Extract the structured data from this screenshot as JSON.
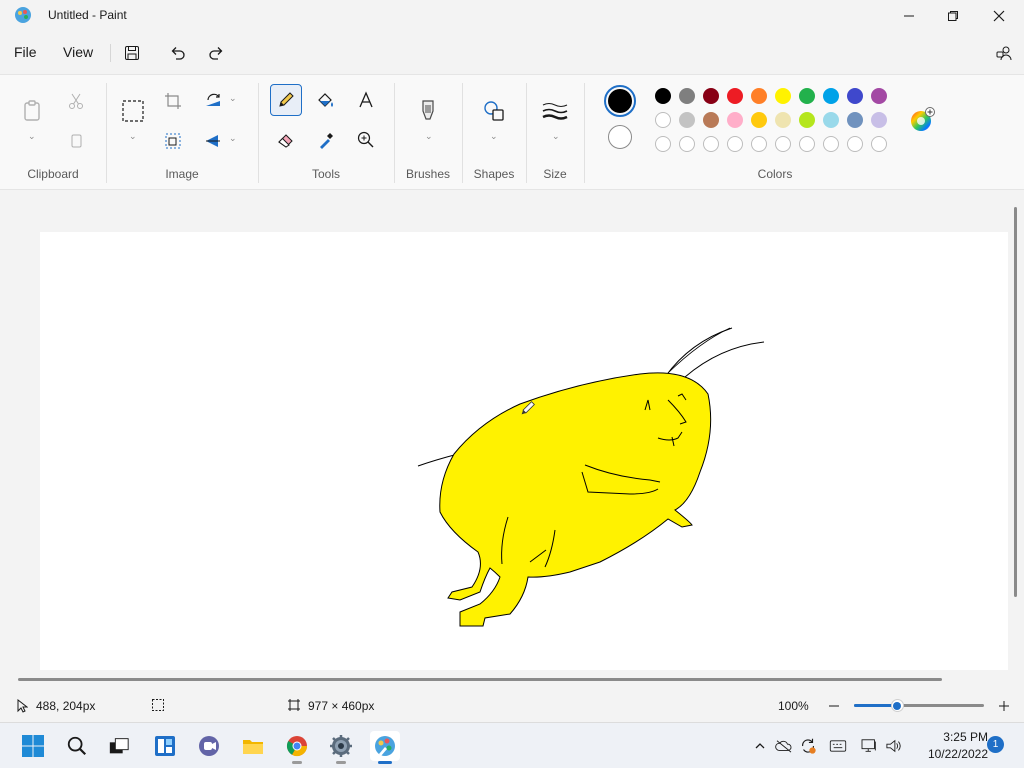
{
  "window": {
    "title": "Untitled - Paint"
  },
  "menu": {
    "file": "File",
    "view": "View"
  },
  "ribbon": {
    "groups": {
      "clipboard": "Clipboard",
      "image": "Image",
      "tools": "Tools",
      "brushes": "Brushes",
      "shapes": "Shapes",
      "size": "Size",
      "colors": "Colors"
    }
  },
  "colors": {
    "primary": "#000000",
    "secondary": "#ffffff",
    "palette_row1": [
      "#000000",
      "#7f7f7f",
      "#880015",
      "#ed1c24",
      "#ff7f27",
      "#fff200",
      "#22b14c",
      "#00a2e8",
      "#3f48cc",
      "#a349a4"
    ],
    "palette_row2": [
      "#ffffff",
      "#c3c3c3",
      "#b97a57",
      "#ffaec9",
      "#ffc90e",
      "#efe4b0",
      "#b5e61d",
      "#99d9ea",
      "#7092be",
      "#c8bfe7"
    ],
    "accent": "#1f6fc7"
  },
  "status": {
    "cursor_position": "488, 204px",
    "canvas_size": "977 × 460px",
    "zoom": "100%",
    "zoom_level": 0.33
  },
  "taskbar": {
    "time": "3:25 PM",
    "date": "10/22/2022",
    "notification_count": "1"
  }
}
